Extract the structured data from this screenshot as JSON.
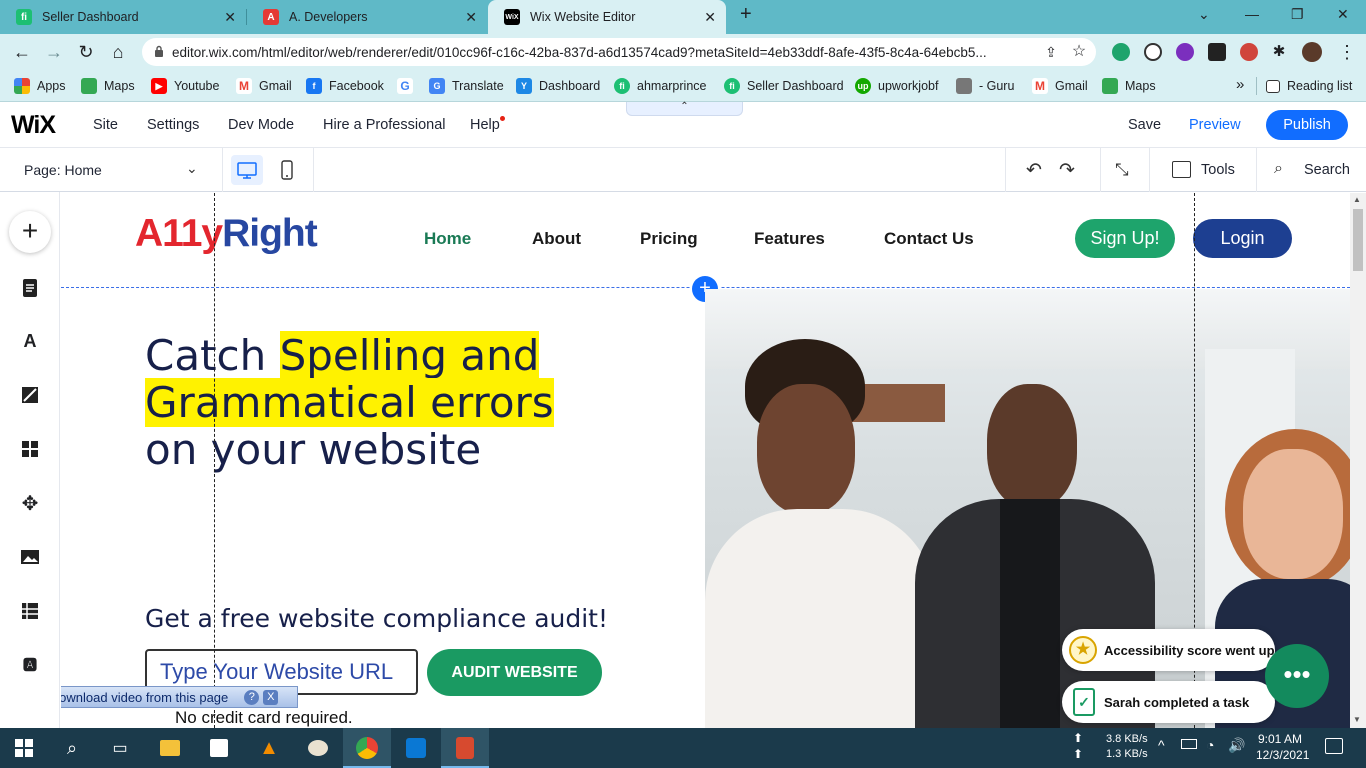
{
  "browser": {
    "tabs": [
      {
        "title": "Seller Dashboard",
        "icon": "fiverr-icon",
        "color": "#1dbf73"
      },
      {
        "title": "A. Developers",
        "icon": "a-icon",
        "color": "#e53935"
      },
      {
        "title": "Wix Website Editor",
        "icon": "wix-icon",
        "color": "#000000"
      }
    ],
    "url": "editor.wix.com/html/editor/web/renderer/edit/010cc96f-c16c-42ba-837d-a6d13574cad9?metaSiteId=4eb33ddf-8afe-43f5-8c4a-64ebcb5...",
    "bookmarks": [
      {
        "label": "Apps",
        "icon": "apps-icon",
        "color": "#ea4335"
      },
      {
        "label": "Maps",
        "icon": "maps-icon",
        "color": "#34a853"
      },
      {
        "label": "Youtube",
        "icon": "youtube-icon",
        "color": "#ff0000"
      },
      {
        "label": "Gmail",
        "icon": "gmail-icon",
        "color": "#ea4335"
      },
      {
        "label": "Facebook",
        "icon": "facebook-icon",
        "color": "#1877f2"
      },
      {
        "label": "",
        "icon": "google-icon",
        "color": "#4285f4"
      },
      {
        "label": "Translate",
        "icon": "translate-icon",
        "color": "#4285f4"
      },
      {
        "label": "Dashboard",
        "icon": "dashboard-icon",
        "color": "#1e88e5"
      },
      {
        "label": "ahmarprince",
        "icon": "fiverr-icon",
        "color": "#1dbf73"
      },
      {
        "label": "Seller Dashboard",
        "icon": "fiverr-icon",
        "color": "#1dbf73"
      },
      {
        "label": "upworkjobf",
        "icon": "upwork-icon",
        "color": "#14a800"
      },
      {
        "label": "- Guru",
        "icon": "guru-icon",
        "color": "#555555"
      },
      {
        "label": "Gmail",
        "icon": "gmail-icon",
        "color": "#ea4335"
      },
      {
        "label": "Maps",
        "icon": "maps-icon",
        "color": "#34a853"
      }
    ],
    "more": "»",
    "reading_list": "Reading list"
  },
  "wix": {
    "logo": "WiX",
    "menu": [
      "Site",
      "Settings",
      "Dev Mode",
      "Hire a Professional",
      "Help"
    ],
    "save": "Save",
    "preview": "Preview",
    "publish": "Publish",
    "page_label": "Page: Home",
    "tools": "Tools",
    "search": "Search",
    "accent": "#116dff"
  },
  "site": {
    "logo_a": "A",
    "logo_11": "11",
    "logo_y": "y",
    "logo_right": "Right",
    "nav": [
      "Home",
      "About",
      "Pricing",
      "Features",
      "Contact Us"
    ],
    "signup": "Sign Up!",
    "login": "Login",
    "headline_1": "Catch ",
    "headline_hl1": "Spelling and",
    "headline_hl2": "Grammatical errors",
    "headline_3": "on your website",
    "subhead": "Get a free website compliance audit!",
    "url_placeholder": "Type Your Website URL",
    "audit_button": "AUDIT WEBSITE",
    "no_card": "No credit card required.",
    "notif_1": "Accessibility score went up",
    "notif_2": "Sarah completed a task",
    "green": "#1a9a62",
    "navy": "#1d3f91"
  },
  "video_bar": {
    "label": "Download video from this page",
    "help": "?",
    "close": "X"
  },
  "taskbar": {
    "net_up": "3.8 KB/s",
    "net_down": "1.3 KB/s",
    "time": "9:01 AM",
    "date": "12/3/2021"
  }
}
